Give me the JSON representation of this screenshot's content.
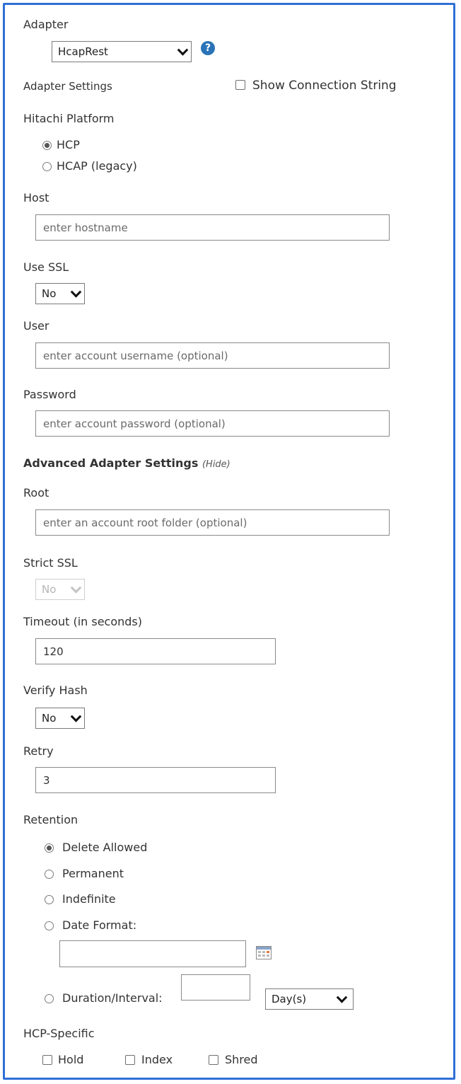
{
  "adapter": {
    "label": "Adapter",
    "selected": "HcapRest",
    "help_icon": "question-mark-icon",
    "help_glyph": "?"
  },
  "adapter_settings": {
    "label": "Adapter Settings",
    "show_connection_string": {
      "label": "Show Connection String",
      "checked": false
    }
  },
  "hitachi_platform": {
    "label": "Hitachi Platform",
    "options": [
      {
        "label": "HCP",
        "selected": true
      },
      {
        "label": "HCAP (legacy)",
        "selected": false
      }
    ]
  },
  "host": {
    "label": "Host",
    "value": "",
    "placeholder": "enter hostname"
  },
  "use_ssl": {
    "label": "Use SSL",
    "selected": "No"
  },
  "user": {
    "label": "User",
    "value": "",
    "placeholder": "enter account username (optional)"
  },
  "password": {
    "label": "Password",
    "value": "",
    "placeholder": "enter account password (optional)"
  },
  "advanced": {
    "label": "Advanced Adapter Settings",
    "toggle": "(Hide)"
  },
  "root": {
    "label": "Root",
    "value": "",
    "placeholder": "enter an account root folder (optional)"
  },
  "strict_ssl": {
    "label": "Strict SSL",
    "selected": "No",
    "disabled": true
  },
  "timeout": {
    "label": "Timeout (in seconds)",
    "value": "120"
  },
  "verify_hash": {
    "label": "Verify Hash",
    "selected": "No"
  },
  "retry": {
    "label": "Retry",
    "value": "3"
  },
  "retention": {
    "label": "Retention",
    "options": [
      {
        "label": "Delete Allowed",
        "selected": true
      },
      {
        "label": "Permanent",
        "selected": false
      },
      {
        "label": "Indefinite",
        "selected": false
      },
      {
        "label": "Date Format:",
        "selected": false
      },
      {
        "label": "Duration/Interval:",
        "selected": false
      }
    ],
    "date_value": "",
    "calendar_icon": "calendar-icon",
    "duration_value": "",
    "duration_unit": "Day(s)"
  },
  "hcp_specific": {
    "label": "HCP-Specific",
    "options": [
      {
        "label": "Hold",
        "checked": false
      },
      {
        "label": "Index",
        "checked": false
      },
      {
        "label": "Shred",
        "checked": false
      }
    ]
  },
  "colors": {
    "frame": "#2f6fd6",
    "help": "#2a73b8"
  }
}
